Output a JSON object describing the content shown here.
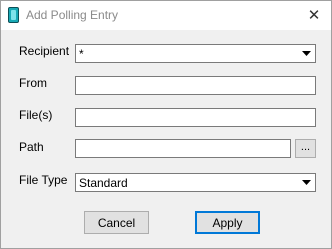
{
  "window": {
    "title": "Add Polling Entry",
    "close_glyph": "✕",
    "icon": "app-icon"
  },
  "form": {
    "recipient": {
      "label": "Recipient",
      "value": "*"
    },
    "from": {
      "label": "From",
      "value": ""
    },
    "files": {
      "label": "File(s)",
      "value": ""
    },
    "path": {
      "label": "Path",
      "value": "",
      "browse_label": "..."
    },
    "file_type": {
      "label": "File Type",
      "value": "Standard"
    }
  },
  "buttons": {
    "cancel": "Cancel",
    "apply": "Apply"
  }
}
